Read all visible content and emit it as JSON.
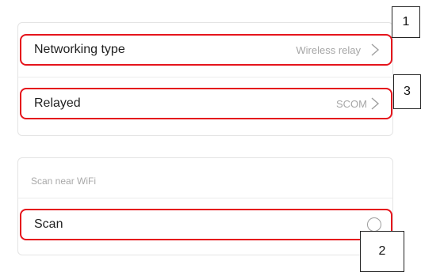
{
  "network_card": {
    "rows": [
      {
        "label": "Networking type",
        "value": "Wireless relay",
        "icon": "chevron-right-icon"
      },
      {
        "label": "Relayed",
        "value": "SCOM",
        "icon": "chevron-right-icon"
      }
    ]
  },
  "scan_card": {
    "caption": "Scan near WiFi",
    "row": {
      "label": "Scan",
      "icon": "radio-circle-icon"
    }
  },
  "callouts": [
    "1",
    "3",
    "2"
  ],
  "colors": {
    "highlight": "#e5141c",
    "muted_text": "#a6a6a6",
    "text": "#1f1f1f",
    "card_border": "#e4e4e4"
  }
}
